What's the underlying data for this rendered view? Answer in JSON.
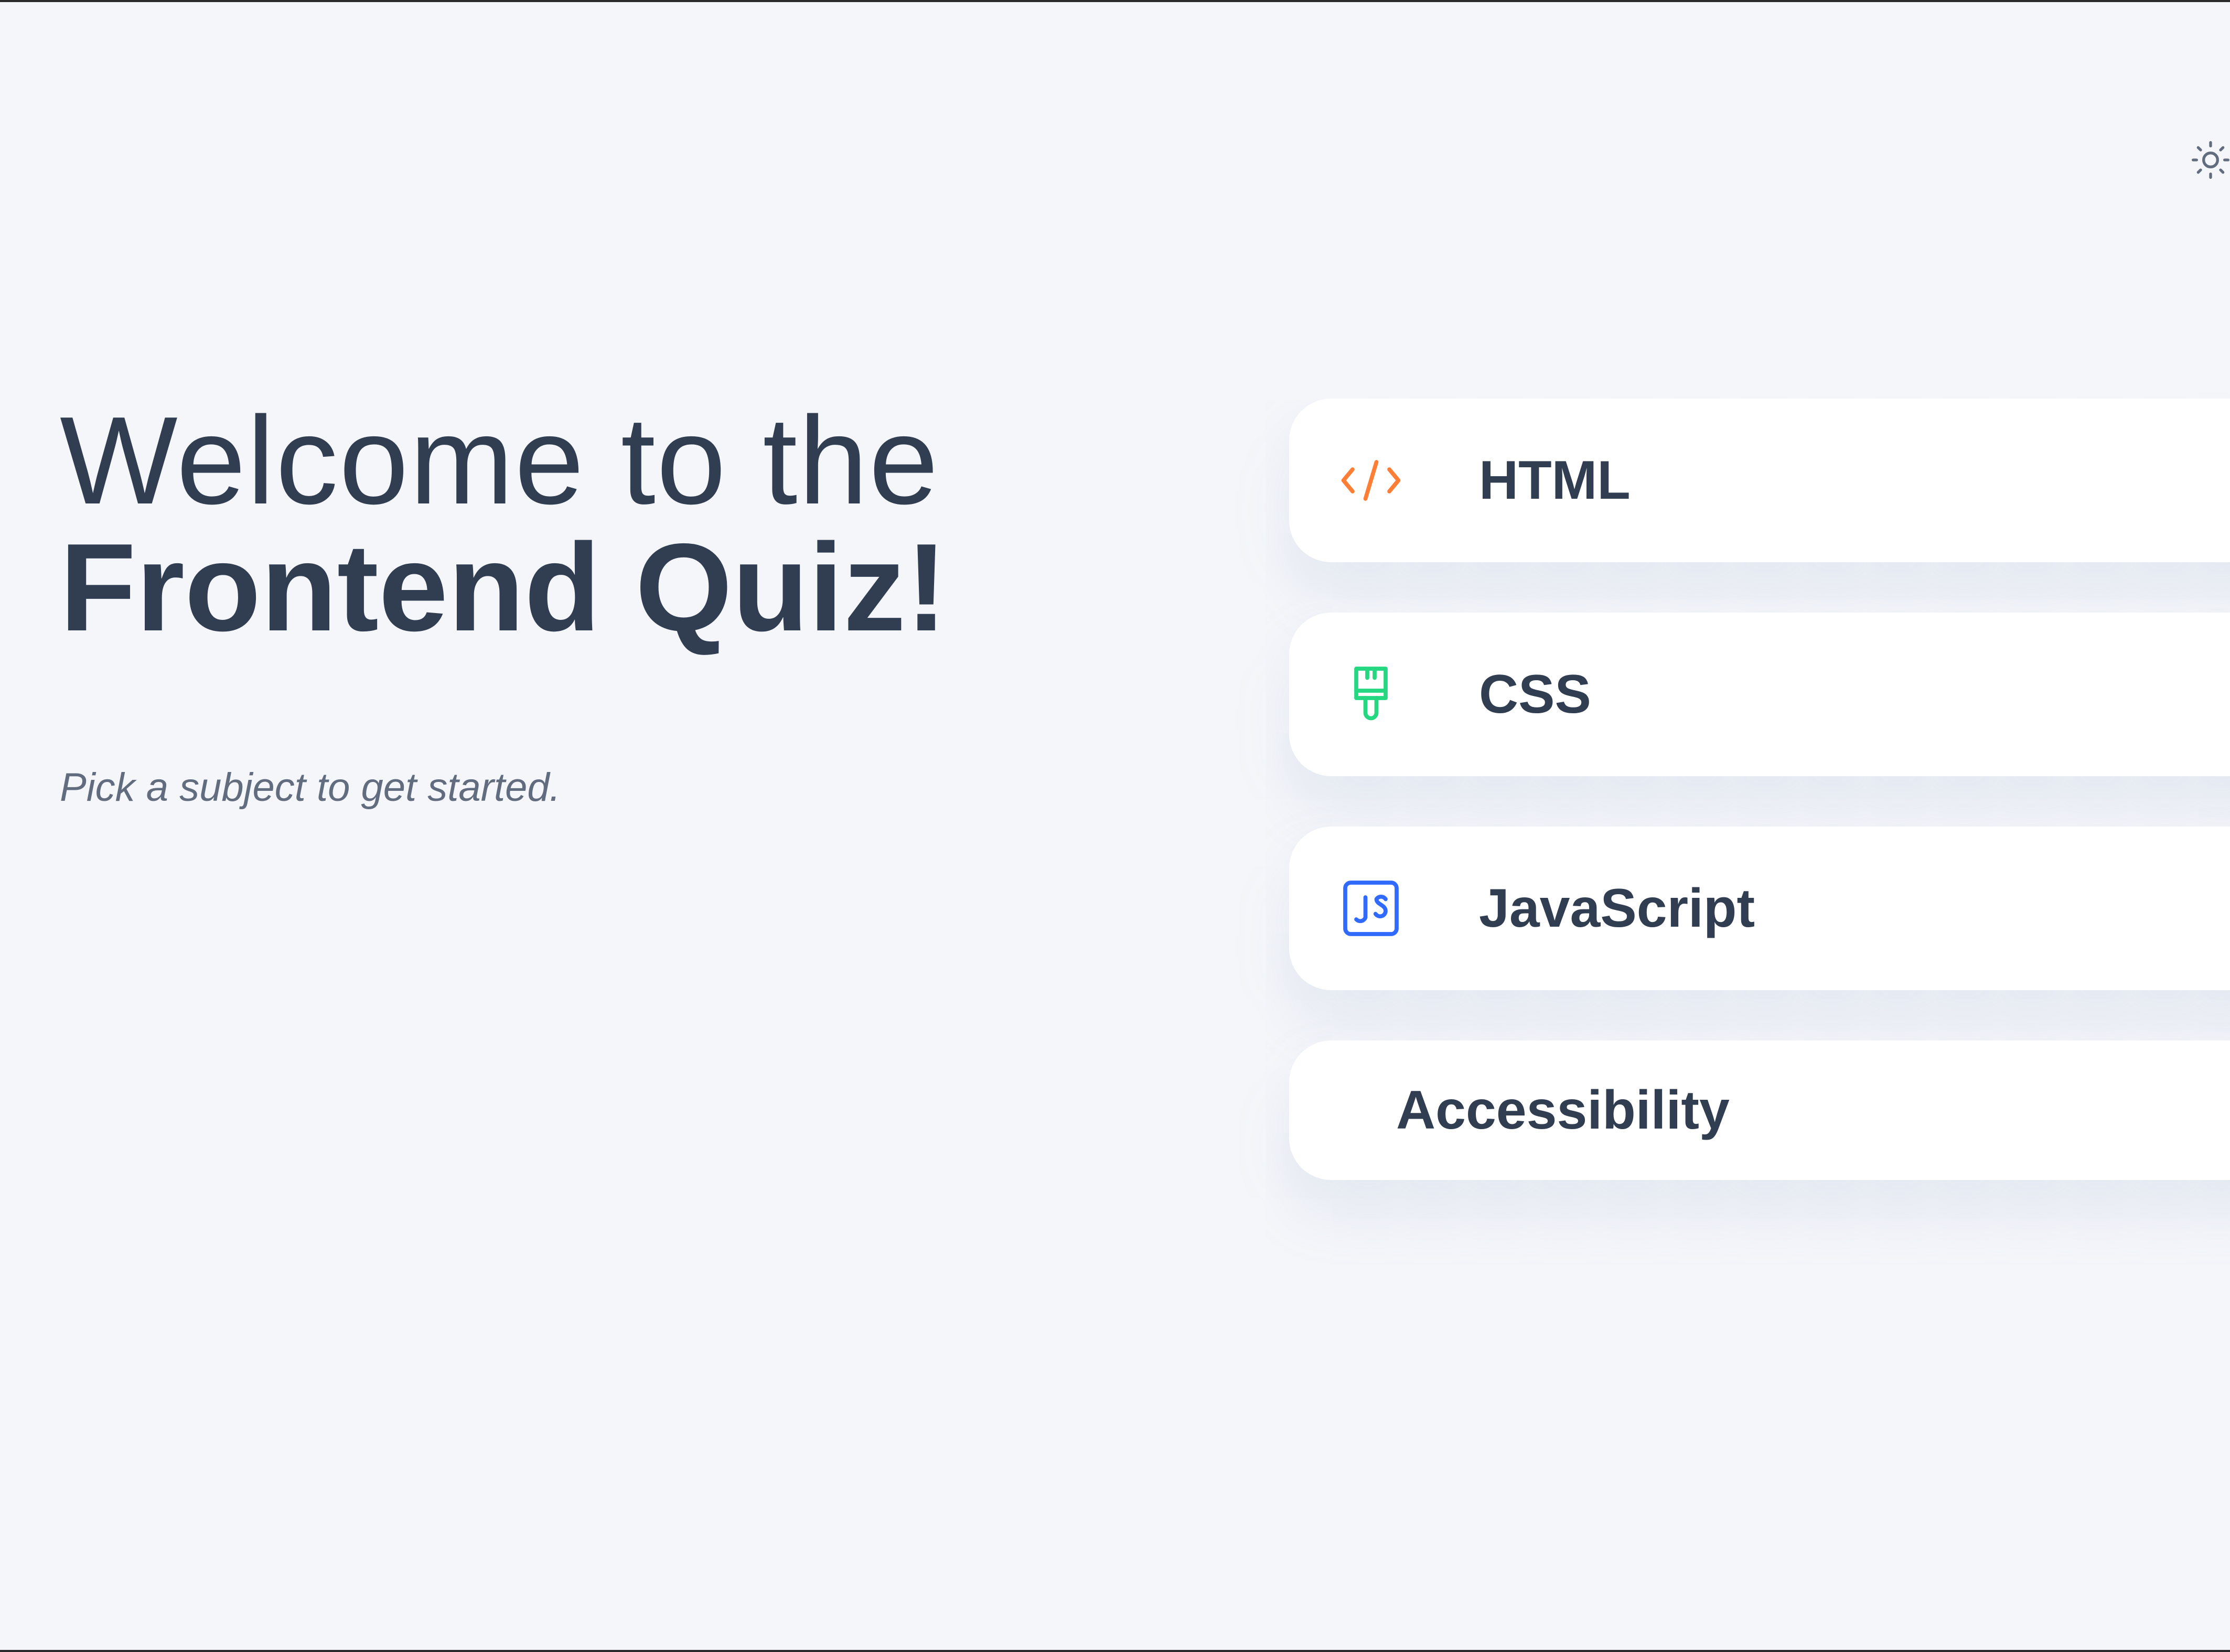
{
  "header": {
    "theme_toggle_icon": "sun-icon"
  },
  "welcome": {
    "line1": "Welcome to the",
    "line2": "Frontend Quiz!",
    "subtitle": "Pick a subject to get started."
  },
  "subjects": [
    {
      "label": "HTML",
      "icon": "code-icon",
      "color": "#ff7e35"
    },
    {
      "label": "CSS",
      "icon": "paintbrush-icon",
      "color": "#26d782"
    },
    {
      "label": "JavaScript",
      "icon": "js-icon",
      "color": "#306aff"
    },
    {
      "label": "Accessibility"
    }
  ],
  "colors": {
    "background": "#f4f6fa",
    "text": "#313e51",
    "subtle_text": "#626c7f",
    "card": "#ffffff"
  }
}
